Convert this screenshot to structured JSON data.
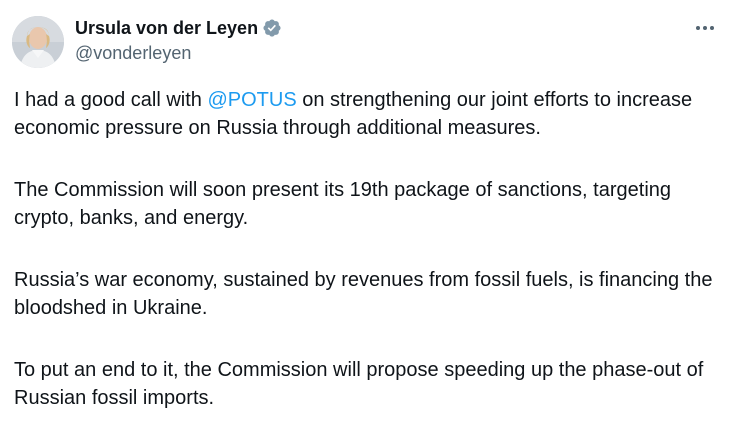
{
  "author": {
    "display_name": "Ursula von der Leyen",
    "handle": "@vonderleyen",
    "verified_badge": "gray-verified-badge"
  },
  "menu_icon": "more-horizontal-icon",
  "tweet": {
    "p1_before": "I had a good call with ",
    "p1_mention": "@POTUS",
    "p1_after": " on strengthening our joint efforts to increase economic pressure on Russia through additional measures.",
    "p2": "The Commission will soon present its 19th package of sanctions, targeting crypto, banks, and energy.",
    "p3": "Russia’s war economy, sustained by revenues from fossil fuels, is financing the bloodshed in Ukraine.",
    "p4": "To put an end to it, the Commission will propose speeding up the phase-out of Russian fossil imports."
  },
  "colors": {
    "text": "#0f1419",
    "secondary": "#536471",
    "link": "#1d9bf0",
    "badge": "#829aab"
  }
}
